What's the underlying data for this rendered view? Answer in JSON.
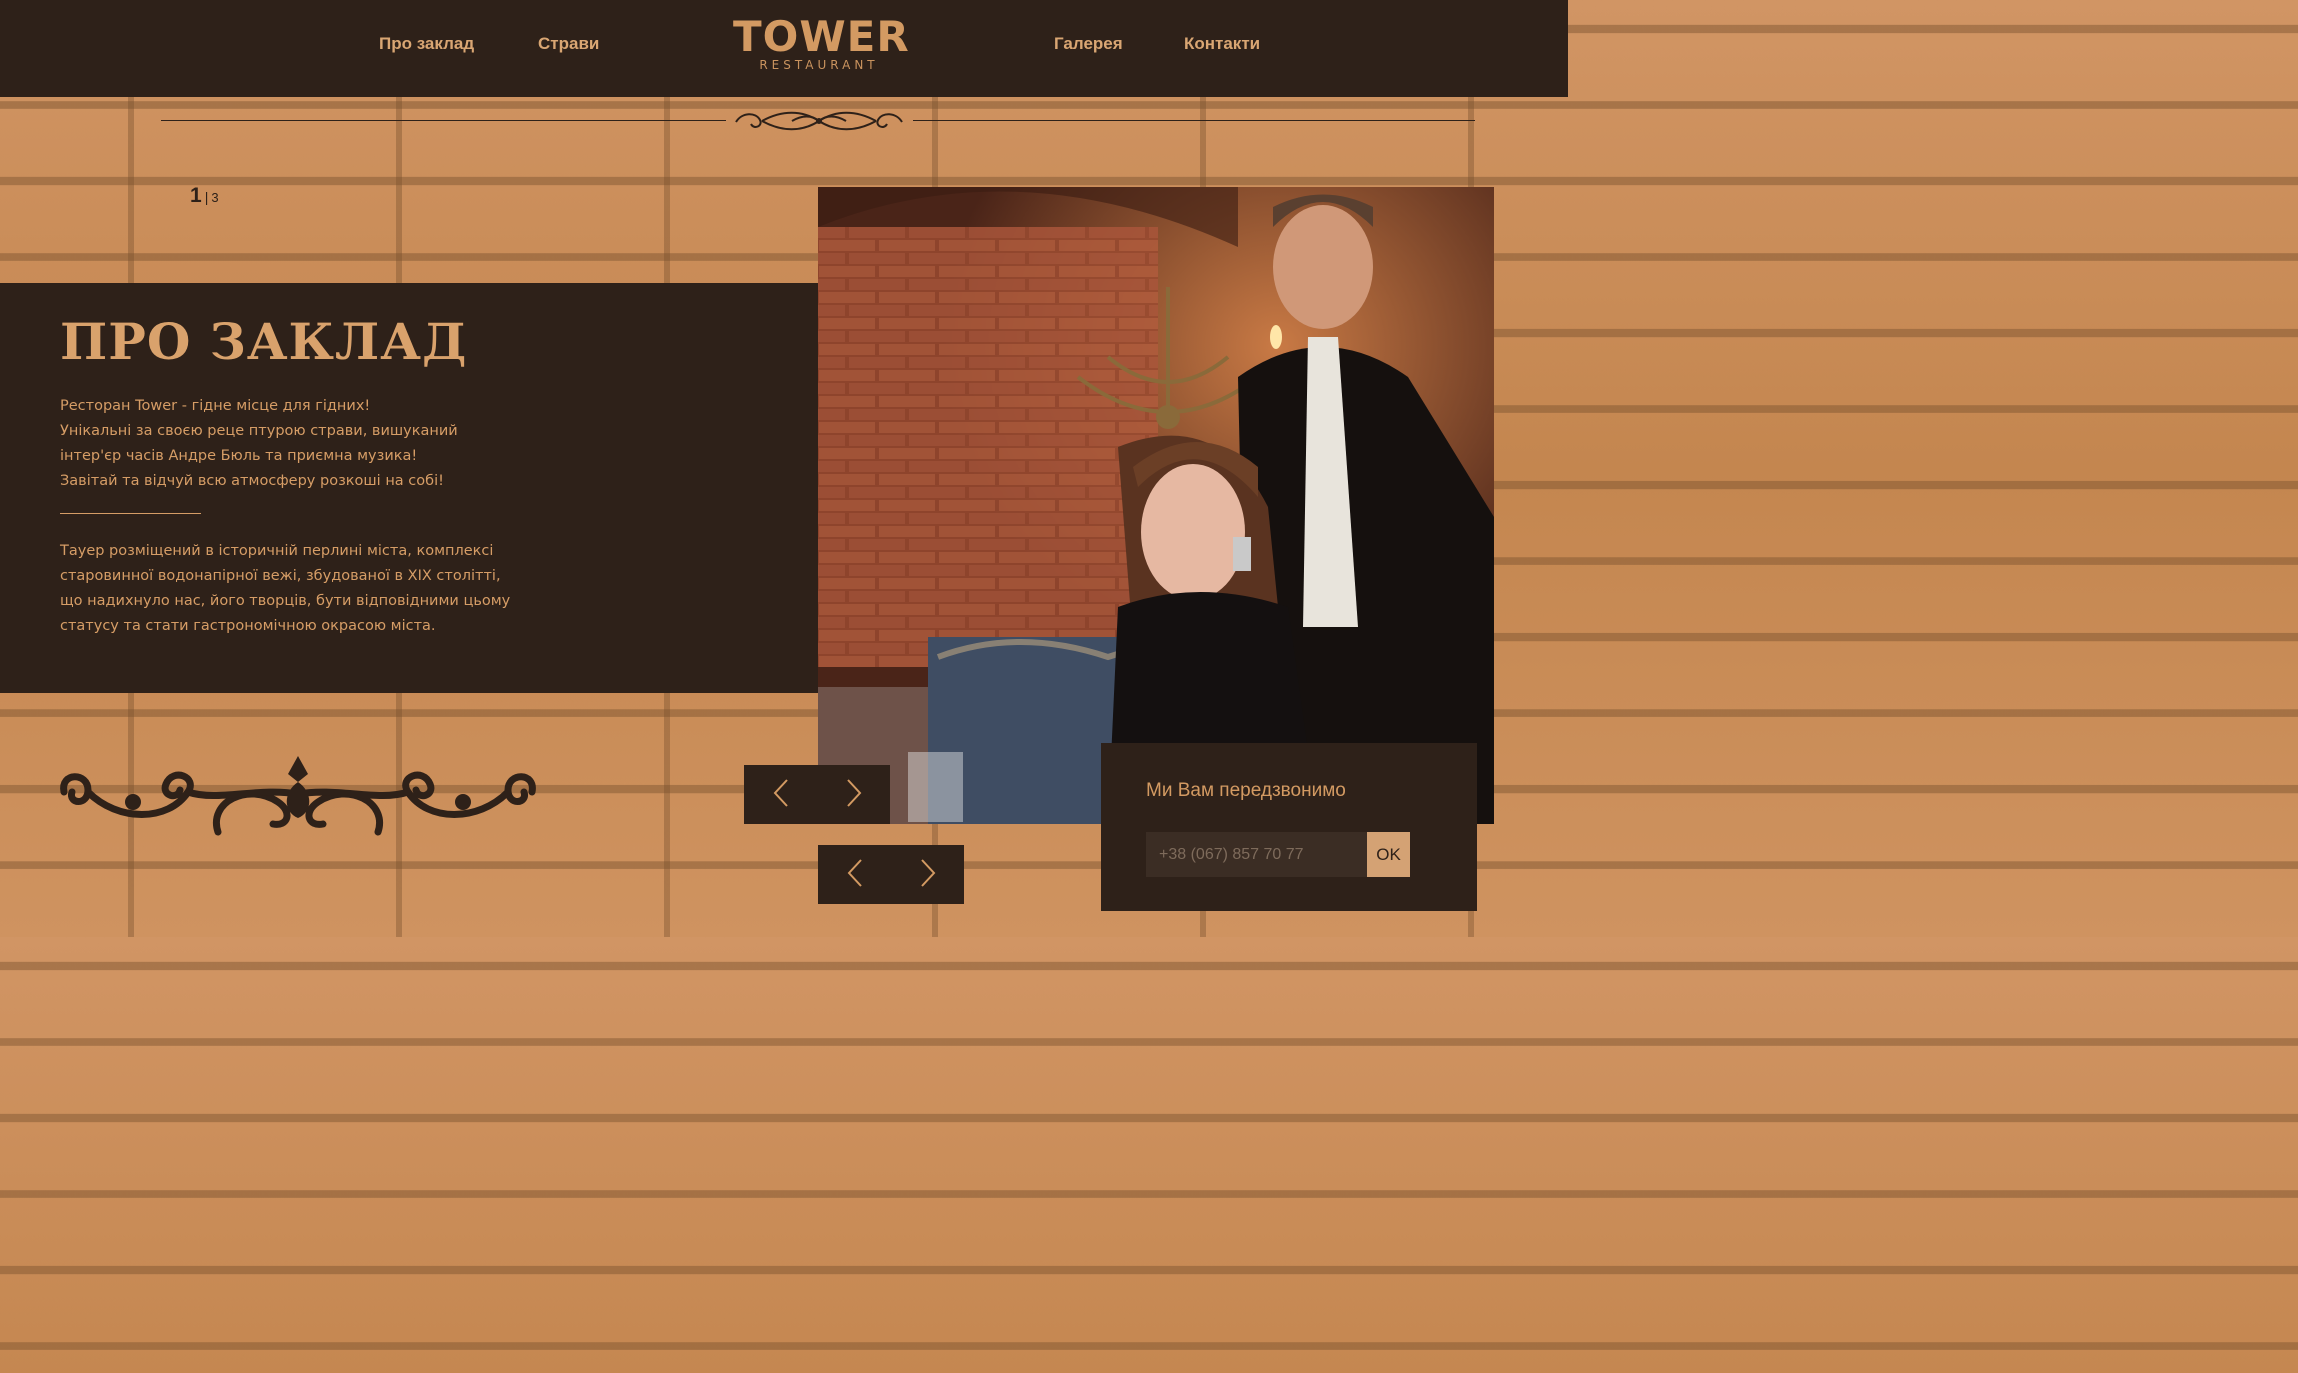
{
  "header": {
    "nav_left": [
      {
        "label": "Про заклад"
      },
      {
        "label": "Страви"
      }
    ],
    "logo": {
      "main": "TOWER",
      "sub": "RESTAURANT"
    },
    "nav_right": [
      {
        "label": "Галерея"
      },
      {
        "label": "Контакти"
      }
    ]
  },
  "slider": {
    "current": "1",
    "separator": "|",
    "total": "3"
  },
  "about": {
    "title": "ПРО ЗАКЛАД",
    "paragraph1": [
      "Ресторан Tower - гідне місце для гідних!",
      "Унікальні за своєю реце птурою страви, вишуканий",
      "інтер'єр часів Андре Бюль та приємна музика!",
      "Завітай та відчуй всю атмосферу розкоші на собі!"
    ],
    "paragraph2": [
      "Тауер розміщений в історичній перлині міста, комплексі",
      "старовинної водонапірної вежі, збудованої в XIX столітті,",
      "що надихнуло нас, його творців, бути відповідними цьому",
      "статусу та стати гастрономічною окрасою міста."
    ]
  },
  "callback": {
    "title": "Ми Вам передзвонимо",
    "phone_placeholder": "+38 (067) 857 70 77",
    "ok_label": "OK"
  },
  "colors": {
    "dark": "#2e2119",
    "accent": "#d39a62",
    "brick": "#c88a55"
  },
  "icons": {
    "prev": "chevron-left-icon",
    "next": "chevron-right-icon",
    "ornament": "ornament-divider-icon",
    "flourish": "flourish-ornament-icon"
  }
}
